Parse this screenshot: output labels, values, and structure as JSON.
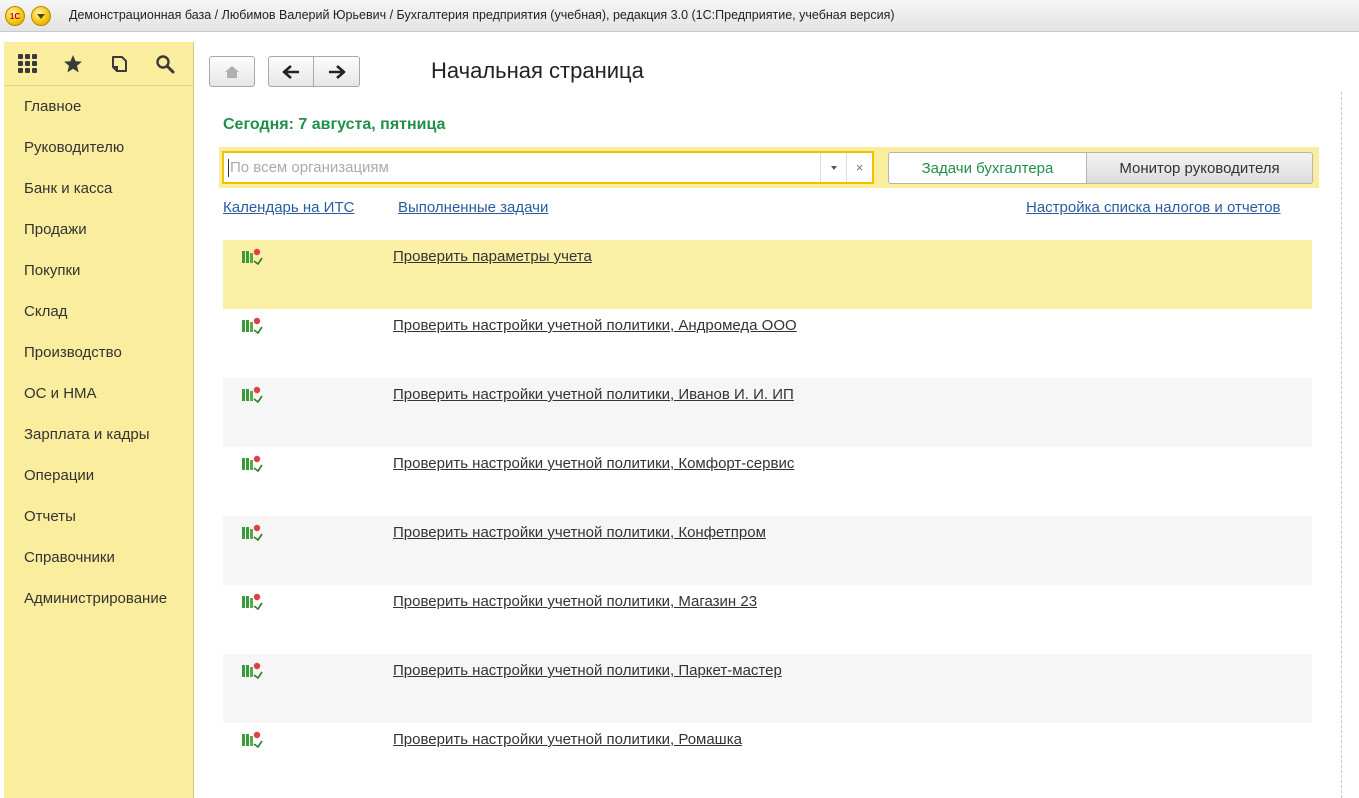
{
  "window": {
    "title": "Демонстрационная база / Любимов Валерий Юрьевич / Бухгалтерия предприятия (учебная), редакция 3.0  (1С:Предприятие, учебная версия)",
    "logo_text": "1С"
  },
  "sidebar": {
    "top_icons": [
      "grid-icon",
      "star-icon",
      "history-icon",
      "search-icon"
    ],
    "items": [
      {
        "label": "Главное"
      },
      {
        "label": "Руководителю"
      },
      {
        "label": "Банк и касса"
      },
      {
        "label": "Продажи"
      },
      {
        "label": "Покупки"
      },
      {
        "label": "Склад"
      },
      {
        "label": "Производство"
      },
      {
        "label": "ОС и НМА"
      },
      {
        "label": "Зарплата и кадры"
      },
      {
        "label": "Операции"
      },
      {
        "label": "Отчеты"
      },
      {
        "label": "Справочники"
      },
      {
        "label": "Администрирование"
      }
    ]
  },
  "main": {
    "page_title": "Начальная страница",
    "today": "Сегодня: 7 августа, пятница",
    "org_filter": {
      "placeholder": "По всем организациям",
      "value": ""
    },
    "tabs": [
      {
        "label": "Задачи бухгалтера",
        "active": true
      },
      {
        "label": "Монитор руководителя",
        "active": false
      }
    ],
    "links": {
      "calendar": "Календарь на ИТС",
      "completed": "Выполненные задачи",
      "tax_settings": "Настройка списка налогов и отчетов"
    },
    "tasks": [
      {
        "label": "Проверить параметры учета"
      },
      {
        "label": "Проверить настройки учетной политики, Андромеда ООО"
      },
      {
        "label": "Проверить настройки учетной политики, Иванов И. И. ИП"
      },
      {
        "label": "Проверить настройки учетной политики, Комфорт-сервис"
      },
      {
        "label": "Проверить настройки учетной политики, Конфетпром"
      },
      {
        "label": "Проверить настройки учетной политики, Магазин 23"
      },
      {
        "label": "Проверить настройки учетной политики, Паркет-мастер"
      },
      {
        "label": "Проверить настройки учетной политики, Ромашка"
      }
    ]
  },
  "colors": {
    "sidebar_bg": "#fbed9e",
    "accent_green": "#20904a",
    "link_blue": "#2d5c9e",
    "highlight_row": "#fbf0a6",
    "focus_border": "#f1c100"
  }
}
